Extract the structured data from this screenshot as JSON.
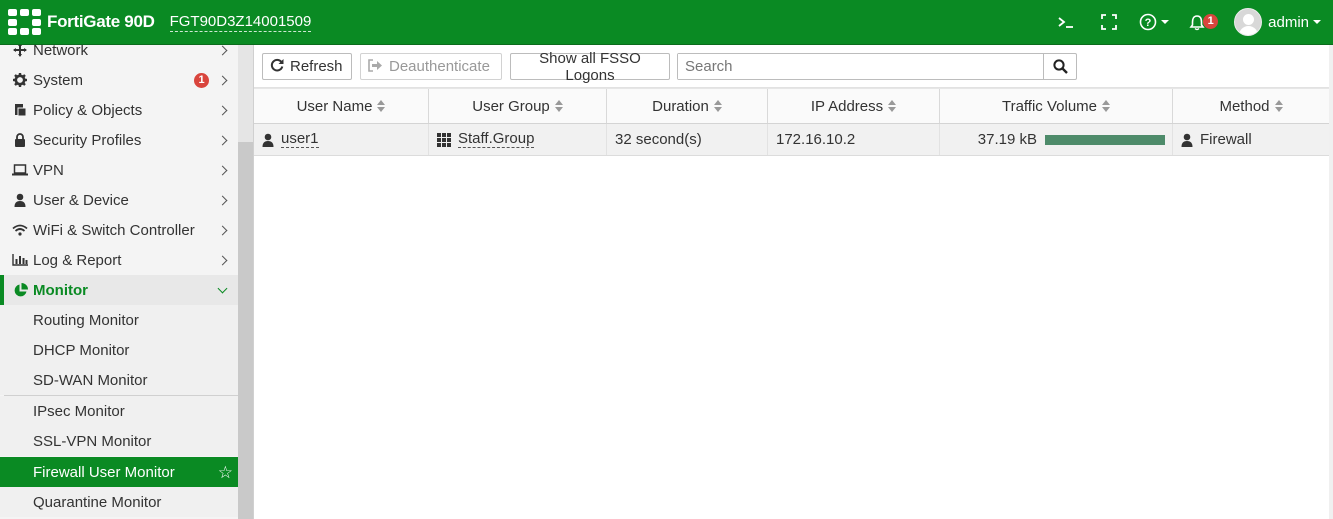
{
  "header": {
    "brand": "FortiGate 90D",
    "serial": "FGT90D3Z14001509",
    "notification_count": "1",
    "user": "admin"
  },
  "sidebar": {
    "items": [
      {
        "label": "Network",
        "icon": "network-icon"
      },
      {
        "label": "System",
        "icon": "gear-icon",
        "badge": "1"
      },
      {
        "label": "Policy & Objects",
        "icon": "policy-icon"
      },
      {
        "label": "Security Profiles",
        "icon": "lock-icon"
      },
      {
        "label": "VPN",
        "icon": "laptop-icon"
      },
      {
        "label": "User & Device",
        "icon": "user-icon"
      },
      {
        "label": "WiFi & Switch Controller",
        "icon": "wifi-icon"
      },
      {
        "label": "Log & Report",
        "icon": "bar-chart-icon"
      },
      {
        "label": "Monitor",
        "icon": "pie-chart-icon"
      }
    ],
    "monitor_items": [
      "Routing Monitor",
      "DHCP Monitor",
      "SD-WAN Monitor",
      "IPsec Monitor",
      "SSL-VPN Monitor",
      "Firewall User Monitor",
      "Quarantine Monitor"
    ]
  },
  "toolbar": {
    "refresh_label": "Refresh",
    "deauth_label": "Deauthenticate",
    "fsso_label": "Show all FSSO Logons",
    "search_placeholder": "Search"
  },
  "table": {
    "columns": [
      "User Name",
      "User Group",
      "Duration",
      "IP Address",
      "Traffic Volume",
      "Method"
    ],
    "rows": [
      {
        "user_name": "user1",
        "user_group": "Staff.Group",
        "duration": "32 second(s)",
        "ip_address": "172.16.10.2",
        "traffic_volume": "37.19 kB",
        "traffic_fraction": 1.0,
        "method": "Firewall"
      }
    ]
  },
  "colors": {
    "brand_green": "#0a8a23",
    "badge_red": "#d9453d",
    "traffic_bar": "#4e8b6a"
  }
}
